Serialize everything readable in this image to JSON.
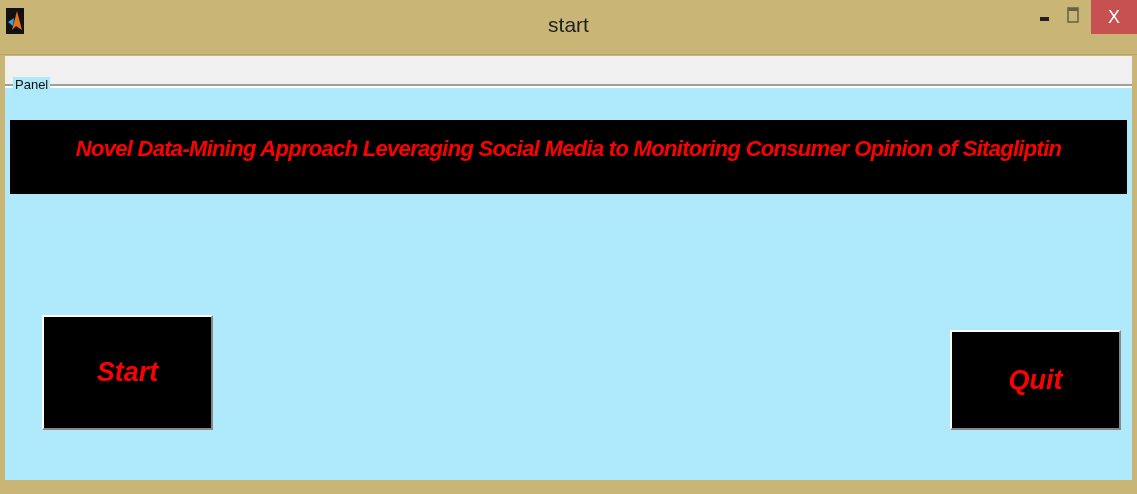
{
  "window": {
    "title": "start",
    "close_label": "X"
  },
  "panel": {
    "label": "Panel",
    "heading": "Novel Data-Mining Approach Leveraging Social Media to Monitoring Consumer Opinion of Sitagliptin",
    "buttons": [
      {
        "label": "Start",
        "kind": "tall"
      },
      {
        "label": "Quit",
        "kind": "short"
      }
    ]
  }
}
